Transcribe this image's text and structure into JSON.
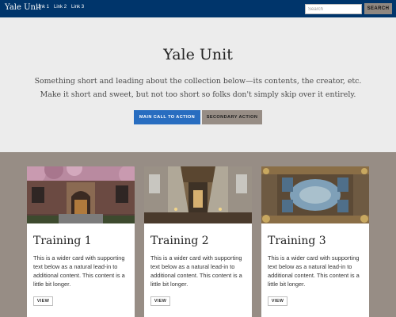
{
  "navbar": {
    "brand": "Yale Unit",
    "links": [
      "Link 1",
      "Link 2",
      "Link 3"
    ],
    "search": {
      "placeholder": "Search",
      "value": "",
      "button_label": "SEARCH"
    }
  },
  "hero": {
    "title": "Yale Unit",
    "lead": "Something short and leading about the collection below—its contents, the creator, etc. Make it short and sweet, but not too short so folks don't simply skip over it entirely.",
    "primary_label": "MAIN CALL TO ACTION",
    "secondary_label": "SECONDARY ACTION"
  },
  "cards": [
    {
      "title": "Training 1",
      "text": "This is a wider card with supporting text below as a natural lead-in to additional content. This content is a little bit longer.",
      "button_label": "VIEW"
    },
    {
      "title": "Training 2",
      "text": "This is a wider card with supporting text below as a natural lead-in to additional content. This content is a little bit longer.",
      "button_label": "VIEW"
    },
    {
      "title": "Training 3",
      "text": "This is a wider card with supporting text below as a natural lead-in to additional content. This content is a little bit longer.",
      "button_label": "VIEW"
    }
  ],
  "colors": {
    "navbar": "#00356b",
    "primary_button": "#286dc0",
    "secondary_button": "#978d85",
    "cards_background": "#978d85",
    "hero_background": "#ececec"
  }
}
